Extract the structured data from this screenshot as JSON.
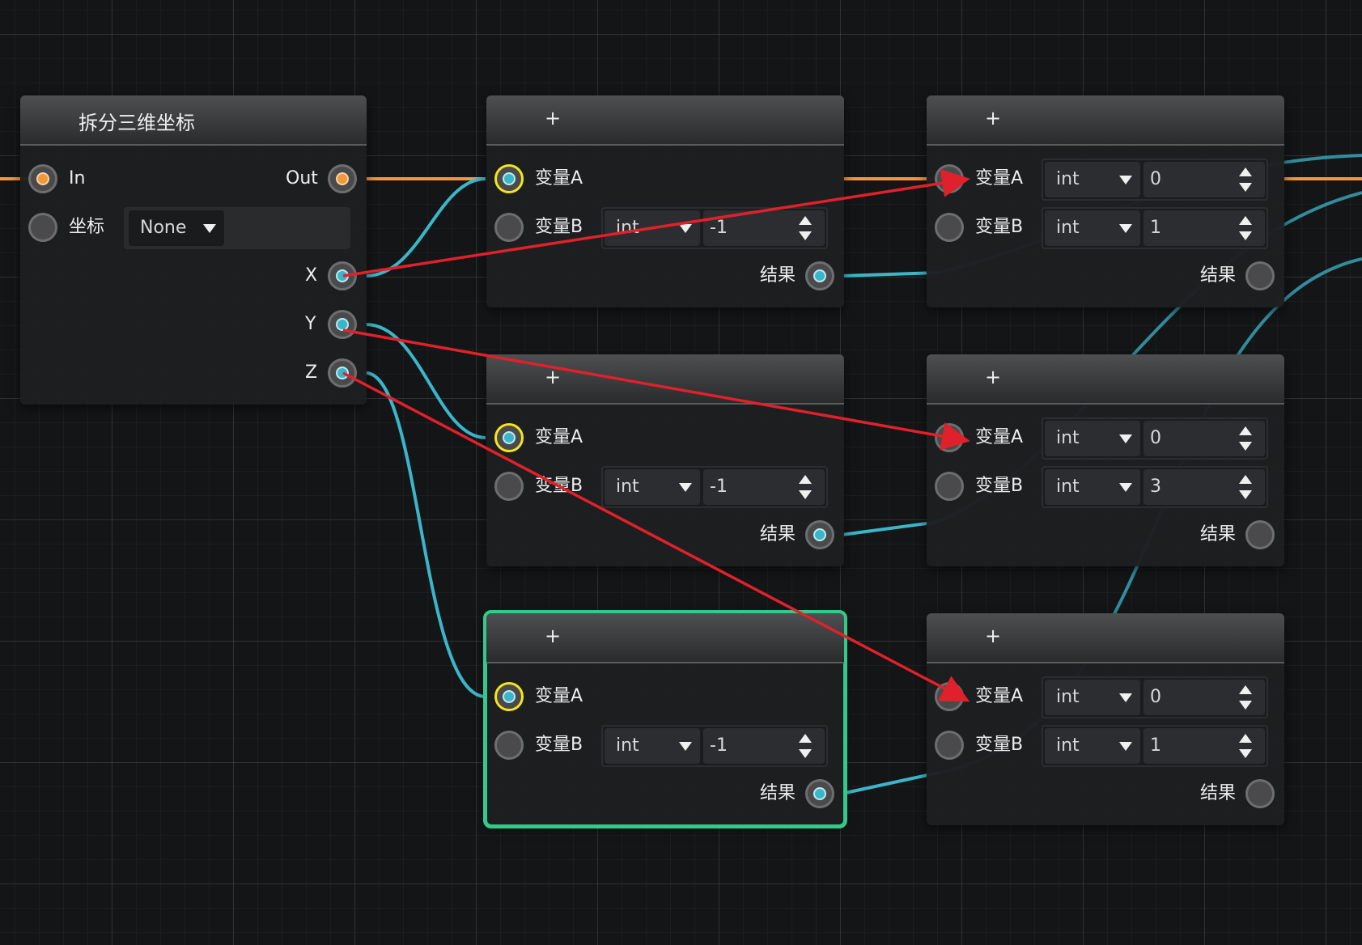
{
  "colors": {
    "exec_wire": "#f0983a",
    "data_wire": "#3bb6c9",
    "red_arrow": "#e0212b",
    "selection": "#34c98a",
    "port_highlight": "#f4e51a"
  },
  "split_node": {
    "title": "拆分三维坐标",
    "in_label": "In",
    "out_label": "Out",
    "coord_label": "坐标",
    "coord_value": "None",
    "x_label": "X",
    "y_label": "Y",
    "z_label": "Z"
  },
  "add_nodes": [
    {
      "title": "+",
      "a_label": "变量A",
      "b_label": "变量B",
      "b_type": "int",
      "b_value": "-1",
      "result_label": "结果"
    },
    {
      "title": "+",
      "a_label": "变量A",
      "b_label": "变量B",
      "b_type": "int",
      "b_value": "-1",
      "result_label": "结果"
    },
    {
      "title": "+",
      "a_label": "变量A",
      "b_label": "变量B",
      "b_type": "int",
      "b_value": "-1",
      "result_label": "结果"
    },
    {
      "title": "+",
      "a_label": "变量A",
      "a_type": "int",
      "a_value": "0",
      "b_label": "变量B",
      "b_type": "int",
      "b_value": "1",
      "result_label": "结果"
    },
    {
      "title": "+",
      "a_label": "变量A",
      "a_type": "int",
      "a_value": "0",
      "b_label": "变量B",
      "b_type": "int",
      "b_value": "3",
      "result_label": "结果"
    },
    {
      "title": "+",
      "a_label": "变量A",
      "a_type": "int",
      "a_value": "0",
      "b_label": "变量B",
      "b_type": "int",
      "b_value": "1",
      "result_label": "结果"
    }
  ]
}
